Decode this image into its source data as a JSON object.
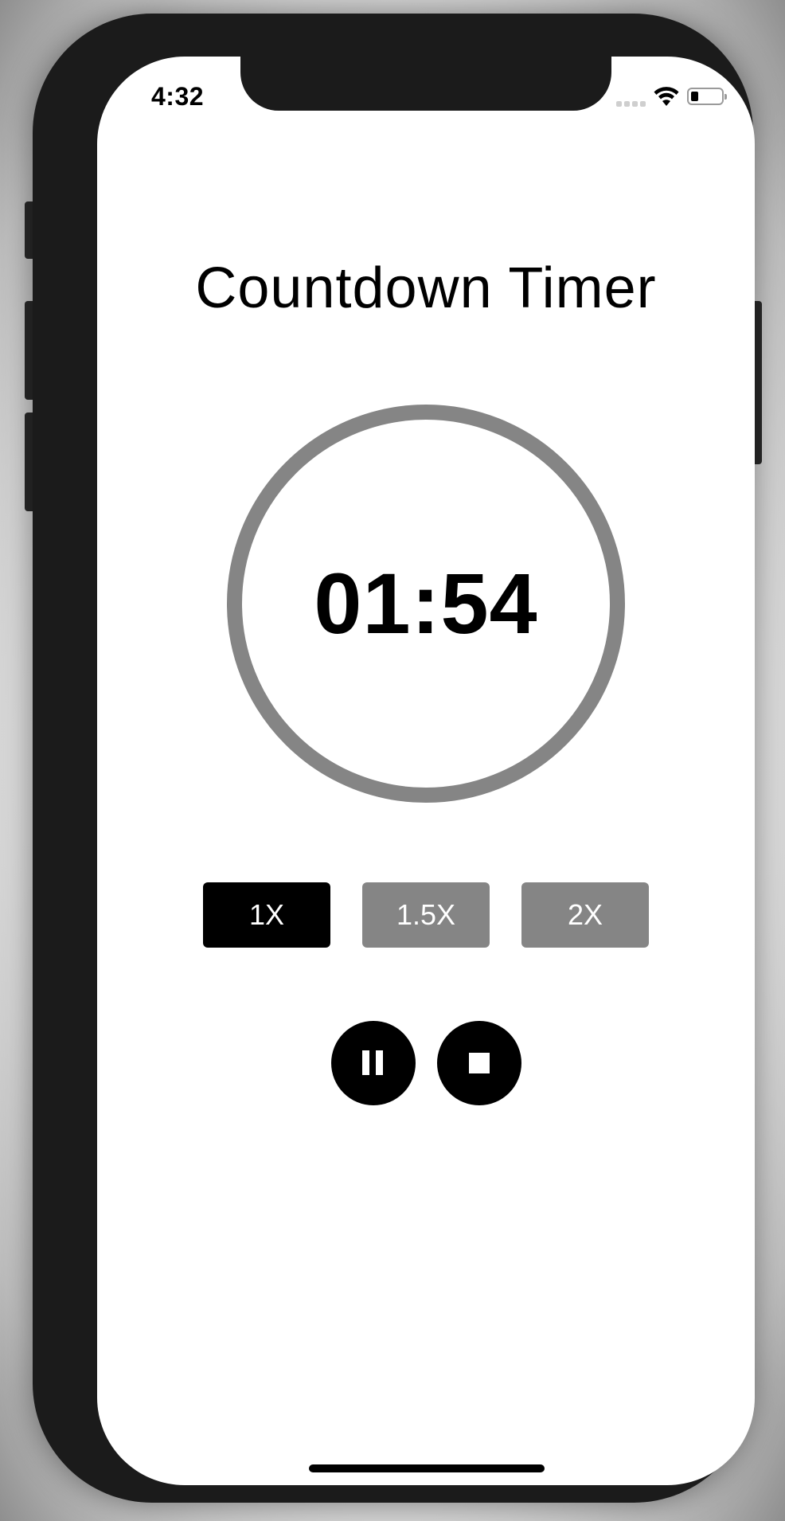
{
  "status_bar": {
    "time": "4:32",
    "battery_level": 0.15
  },
  "app": {
    "title": "Countdown Timer",
    "timer_display": "01:54"
  },
  "speed_options": [
    {
      "label": "1X",
      "selected": true
    },
    {
      "label": "1.5X",
      "selected": false
    },
    {
      "label": "2X",
      "selected": false
    }
  ],
  "controls": {
    "pause_icon": "pause-icon",
    "stop_icon": "stop-icon"
  },
  "colors": {
    "selected": "#000000",
    "unselected": "#858585",
    "ring": "#858585"
  }
}
